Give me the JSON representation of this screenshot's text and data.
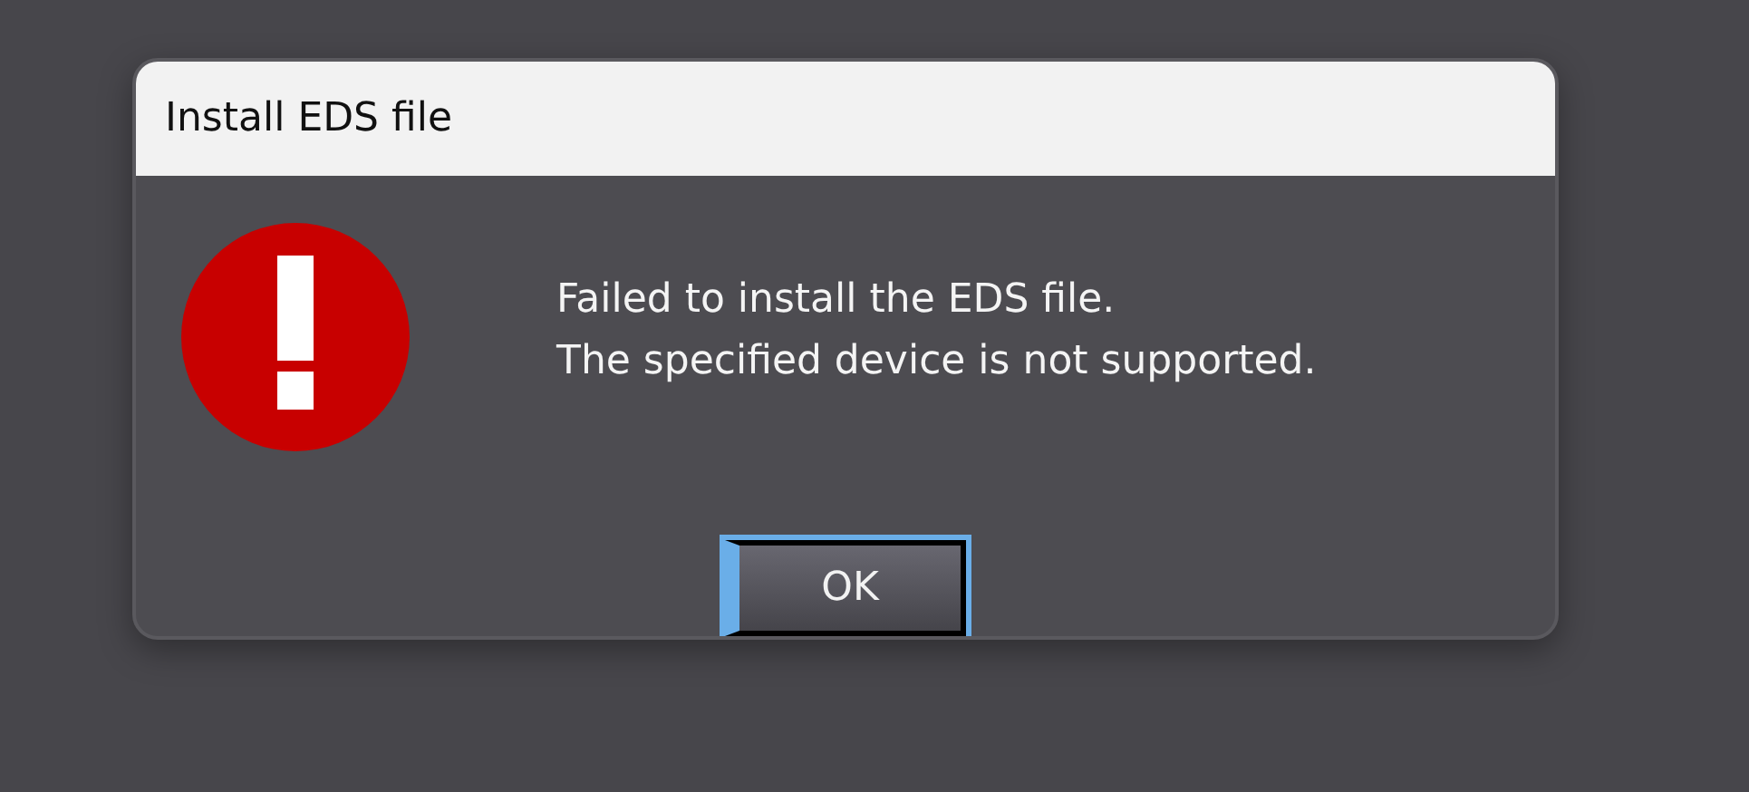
{
  "window": {
    "title": "Install EDS file"
  },
  "message": {
    "kind": "error",
    "lines": [
      "Failed to install the EDS file.",
      "The specified device is not supported."
    ]
  },
  "buttons": [
    {
      "label": "OK",
      "focused": true
    }
  ]
}
